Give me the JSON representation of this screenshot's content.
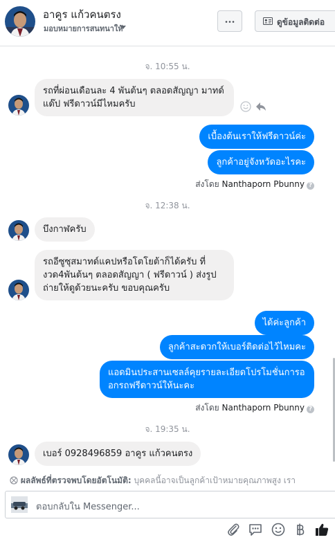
{
  "header": {
    "name": "อาคูร แก้วคนตรง",
    "subtitle": "มอบหมายการสนทนาให้",
    "more_label": "···",
    "info_button_label": "ดูข้อมูลติดต่อ"
  },
  "thread": [
    {
      "type": "timestamp",
      "text": "จ. 10:55 น."
    },
    {
      "type": "incoming",
      "text": "รถที่ผ่อนเดือนละ 4 พันต้นๆ ตลอดสัญญา มาทด์แด๊ป ฟรีดาวน์มีไหมครับ"
    },
    {
      "type": "outgoing",
      "text": "เบื้องต้นเราให้ฟรีดาวน์ค่ะ"
    },
    {
      "type": "outgoing",
      "text": "ลูกค้าอยู่จังหวัดอะไรคะ"
    },
    {
      "type": "sentby",
      "prefix": "ส่งโดย",
      "name": "Nanthaporn Pbunny"
    },
    {
      "type": "timestamp",
      "text": "จ. 12:38 น."
    },
    {
      "type": "incoming",
      "text": "บึงกาฬครับ"
    },
    {
      "type": "incoming",
      "text": "รถอีซูซุสมาทด์แคปหรือโตโยต้าก็ได้ครับ ที่งวด4พันต้นๆ ตลอดสัญญา ( ฟรีดาวน์ ) ส่งรูปถ่ายให้ดูด้วยนะครับ ขอบคุณครับ"
    },
    {
      "type": "outgoing",
      "text": "ได้ค่ะลูกค้า"
    },
    {
      "type": "outgoing",
      "text": "ลูกค้าสะดวกให้เบอร์ติดต่อไว้ไหมคะ"
    },
    {
      "type": "outgoing",
      "text": "แอดมินประสานเซลล์คุยรายละเอียดโปรโมชั่นการออกรถฟรีดาวน์ให้นะคะ"
    },
    {
      "type": "sentby",
      "prefix": "ส่งโดย",
      "name": "Nanthaporn Pbunny"
    },
    {
      "type": "timestamp",
      "text": "จ. 19:35 น."
    },
    {
      "type": "incoming",
      "text": "เบอร์ 0928496859  อาคูร  แก้วคนตรง"
    }
  ],
  "notice": {
    "bold": "ผลลัพธ์ที่ตรวจพบโดยอัตโนมัติ:",
    "text": " บุคคลนี้อาจเป็นลูกค้าเป้าหมายคุณภาพสูง เรา"
  },
  "sent_by_help": "?",
  "composer": {
    "placeholder": "ตอบกลับใน Messenger..."
  },
  "colors": {
    "outgoing_bubble": "#0084ff",
    "incoming_bubble": "#f1f0f0",
    "like_icon": "#1c1e21"
  },
  "icons": [
    "more-icon",
    "contact-card-icon",
    "smile-icon",
    "reply-icon",
    "attachment-icon",
    "saved-reply-icon",
    "emoji-icon",
    "baht-icon",
    "like-icon",
    "insight-icon"
  ]
}
